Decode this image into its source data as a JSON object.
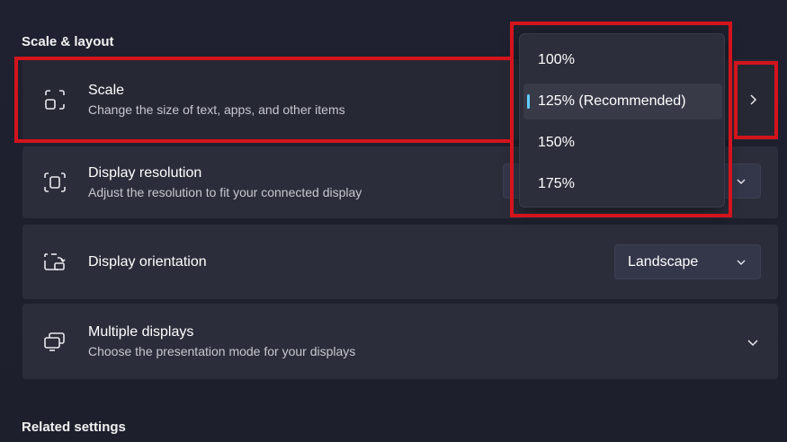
{
  "section": {
    "title": "Scale & layout"
  },
  "scale": {
    "title": "Scale",
    "subtitle": "Change the size of text, apps, and other items",
    "options": [
      "100%",
      "125% (Recommended)",
      "150%",
      "175%"
    ],
    "selected_option": "125% (Recommended)"
  },
  "resolution": {
    "title": "Display resolution",
    "subtitle": "Adjust the resolution to fit your connected display"
  },
  "orientation": {
    "title": "Display orientation",
    "value": "Landscape"
  },
  "multi": {
    "title": "Multiple displays",
    "subtitle": "Choose the presentation mode for your displays"
  },
  "related": {
    "title": "Related settings"
  },
  "colors": {
    "accent": "#60cdff",
    "highlight_red": "#d4141c",
    "card_bg": "#2b2d3a",
    "page_bg": "#1e2030"
  },
  "icons": {
    "scale": "scale-icon",
    "resolution": "resolution-icon",
    "orientation": "orientation-icon",
    "multi": "multiple-displays-icon"
  }
}
